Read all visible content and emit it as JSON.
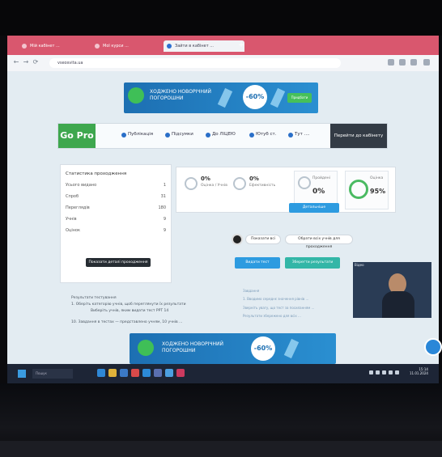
{
  "browser": {
    "tabs": [
      {
        "label": "Мій кабінет ...",
        "active": false
      },
      {
        "label": "Мої курси ...",
        "active": false
      },
      {
        "label": "Зайти в кабінет ...",
        "active": true
      }
    ],
    "url": "vseosvita.ua"
  },
  "ad_banner": {
    "line1": "ХОДЖЕНО НОВОРІЧНИЙ",
    "line2": "ПОГОРОШНИ",
    "badge": "-60%",
    "button": "Придбати"
  },
  "nav": {
    "brand": "Go Pro",
    "items": [
      "Публікація",
      "Підсумки",
      "До ЛІЦЕЮ",
      "Ютуб ст.",
      "Тут ...."
    ],
    "end": "Перейти до кабінету"
  },
  "left_panel": {
    "title": "Статистика проходження",
    "rows": [
      {
        "label": "Усього видано",
        "value": "1"
      },
      {
        "label": "Спроб",
        "value": "31"
      },
      {
        "label": "Переглядів",
        "value": "180"
      },
      {
        "label": "Учнів",
        "value": "9"
      },
      {
        "label": "Оцінок",
        "value": "9"
      }
    ],
    "tooltip": "Показати деталі проходження"
  },
  "stats": {
    "item1_value": "0%",
    "item1_label": "Оцінка / Учнів",
    "item2_value": "0%",
    "item2_label": "Ефективність",
    "card1_title": "Пройдені",
    "card1_value": "0%",
    "card2_title": "Оцінка",
    "card2_value": "95%",
    "button": "Детальніше"
  },
  "controls": {
    "toggle_label": "Показати всі",
    "pill_label": "Обрати всіх учнів для проходження",
    "btn1": "Видати тест",
    "btn2": "Зберегти результати"
  },
  "left_text": [
    "Результати тестування",
    "1. Оберіть категорію учнів, щоб переглянути їх результати",
    "Виберіть учнів, яким видати тест PPT 14",
    "10. Завдання в тестах — представлено учням, 10 учнів ..."
  ],
  "right_text": [
    "Завдання",
    "1. Вводимо середнє значення рівнів ...",
    "Зверніть увагу, що тест за посиланням ...",
    "Результати збережено для всіх ..."
  ],
  "video": {
    "title": "Відео"
  },
  "ad_bottom": {
    "line1": "ХОДЖЕНО НОВОРІЧНИЙ",
    "line2": "ПОГОРОШНИ",
    "badge": "-60%"
  },
  "taskbar": {
    "search_placeholder": "Пошук",
    "time": "15:14",
    "date": "11.01.2024"
  },
  "colors": {
    "tab_bar": "#d9576e",
    "gopro_green": "#3ea74e",
    "accent_blue": "#2d9be0",
    "taskbar": "#1d2536"
  }
}
